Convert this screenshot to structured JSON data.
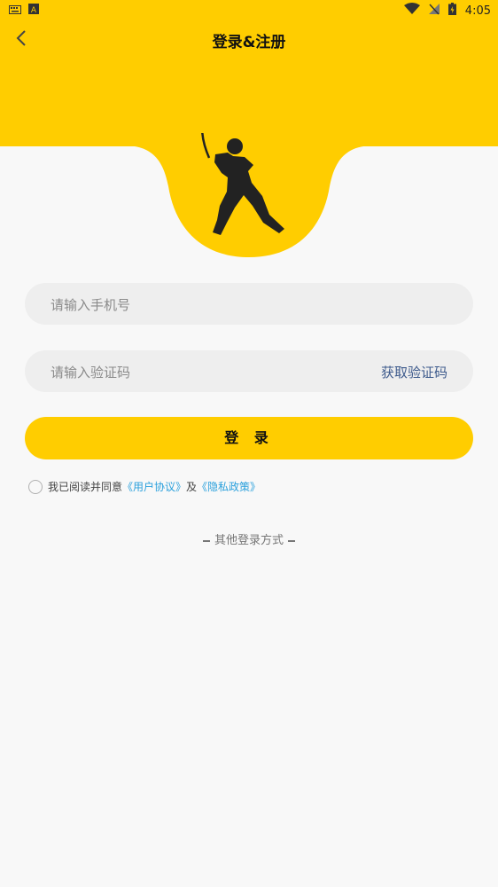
{
  "status_bar": {
    "time": "4:05"
  },
  "nav": {
    "title": "登录&注册"
  },
  "form": {
    "phone_placeholder": "请输入手机号",
    "code_placeholder": "请输入验证码",
    "get_code": "获取验证码",
    "login_button": "登 录"
  },
  "agreement": {
    "prefix": "我已阅读并同意",
    "user_agreement": "《用户协议》",
    "and": "及",
    "privacy_policy": "《隐私政策》"
  },
  "other_login": {
    "label": "其他登录方式"
  },
  "colors": {
    "brand_yellow": "#FFCD00",
    "link_blue": "#2aa0dc",
    "get_code_blue": "#3d5a8c"
  }
}
